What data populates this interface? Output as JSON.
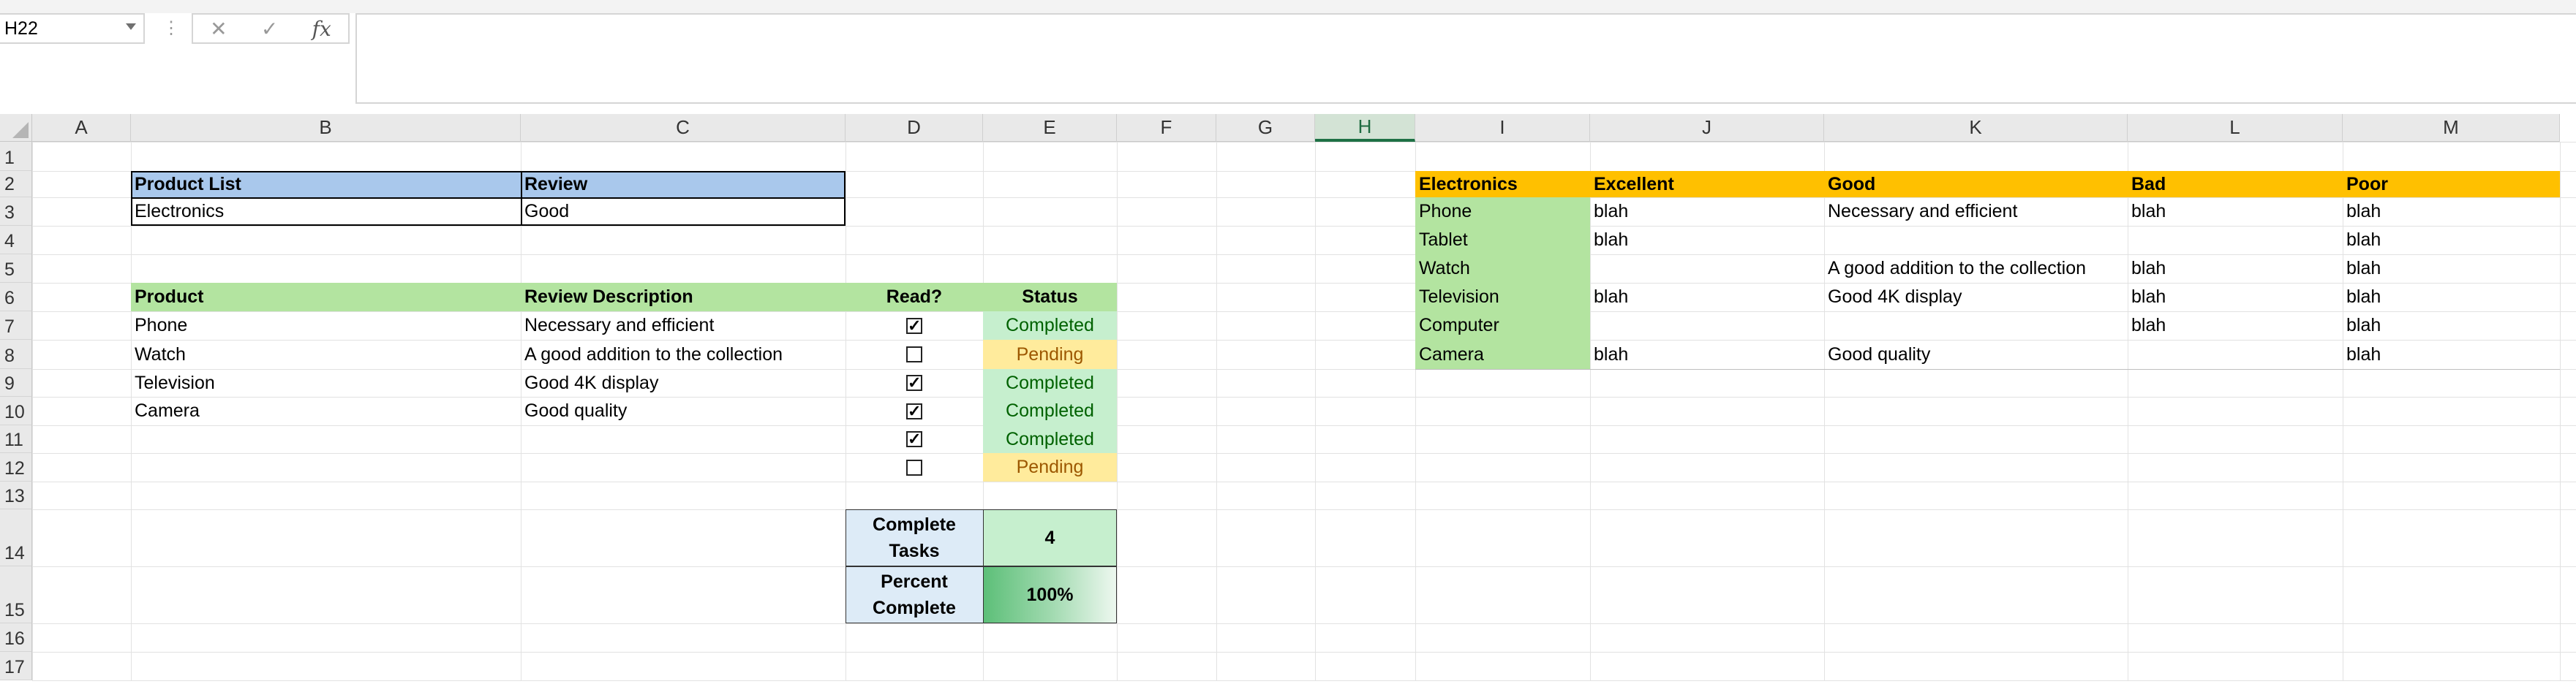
{
  "formula_bar": {
    "name_box": "H22",
    "cancel_icon": "✕",
    "enter_icon": "✓",
    "fx_label": "fx",
    "formula": ""
  },
  "columns": [
    "A",
    "B",
    "C",
    "D",
    "E",
    "F",
    "G",
    "H",
    "I",
    "J",
    "K",
    "L",
    "M"
  ],
  "selected_column": "H",
  "rows": [
    "1",
    "2",
    "3",
    "4",
    "5",
    "6",
    "7",
    "8",
    "9",
    "10",
    "11",
    "12",
    "13",
    "14",
    "15",
    "16",
    "17"
  ],
  "product_review": {
    "header": {
      "product_list": "Product List",
      "review": "Review"
    },
    "values": {
      "product_list": "Electronics",
      "review": "Good"
    }
  },
  "task_table": {
    "headers": {
      "product": "Product",
      "review_description": "Review Description",
      "read": "Read?",
      "status": "Status"
    },
    "rows": [
      {
        "product": "Phone",
        "description": "Necessary and efficient",
        "checked": "✓",
        "status": "Completed"
      },
      {
        "product": "Watch",
        "description": "A good addition to the collection",
        "checked": "",
        "status": "Pending"
      },
      {
        "product": "Television",
        "description": "Good 4K display",
        "checked": "✓",
        "status": "Completed"
      },
      {
        "product": "Camera",
        "description": "Good quality",
        "checked": "✓",
        "status": "Completed"
      },
      {
        "product": "",
        "description": "",
        "checked": "✓",
        "status": "Completed"
      },
      {
        "product": "",
        "description": "",
        "checked": "",
        "status": "Pending"
      }
    ]
  },
  "summary": {
    "complete_tasks_label": "Complete Tasks",
    "complete_tasks_value": "4",
    "percent_complete_label": "Percent Complete",
    "percent_complete_value": "100%",
    "percent_complete_fraction": 1.0
  },
  "lookup_table": {
    "headers": [
      "Electronics",
      "Excellent",
      "Good",
      "Bad",
      "Poor"
    ],
    "rows": [
      [
        "Phone",
        "blah",
        "Necessary and efficient",
        "blah",
        "blah"
      ],
      [
        "Tablet",
        "blah",
        "",
        "",
        "blah"
      ],
      [
        "Watch",
        "",
        "A good addition to the collection",
        "blah",
        "blah"
      ],
      [
        "Television",
        "blah",
        "Good 4K display",
        "blah",
        "blah"
      ],
      [
        "Computer",
        "",
        "",
        "blah",
        "blah"
      ],
      [
        "Camera",
        "blah",
        "Good quality",
        "",
        "blah"
      ]
    ]
  },
  "colors": {
    "header_blue": "#a9c8ec",
    "header_green": "#b3e4a0",
    "header_gold": "#ffc000",
    "completed_fill": "#c6efce",
    "completed_text": "#006100",
    "pending_fill": "#ffeb9c",
    "pending_text": "#9c5700",
    "selected_column": "#1e7145"
  }
}
